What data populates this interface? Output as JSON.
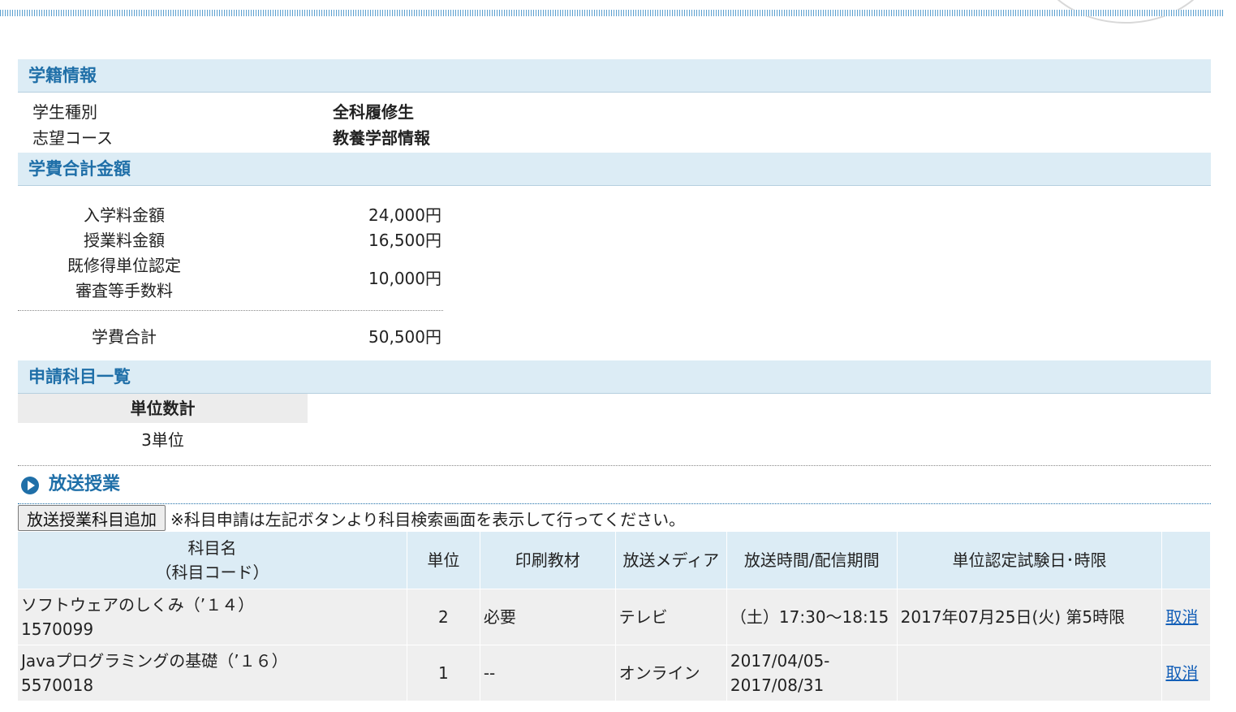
{
  "gakuseki": {
    "title": "学籍情報",
    "rows": [
      {
        "label": "学生種別",
        "value": "全科履修生"
      },
      {
        "label": "志望コース",
        "value": "教養学部情報"
      }
    ]
  },
  "fees": {
    "title": "学費合計金額",
    "rows": [
      {
        "label": "入学料金額",
        "value": "24,000円"
      },
      {
        "label": "授業料金額",
        "value": "16,500円"
      },
      {
        "label1": "既修得単位認定",
        "label2": "審査等手数料",
        "value": "10,000円"
      }
    ],
    "total_label": "学費合計",
    "total_value": "50,500円"
  },
  "subjects": {
    "title": "申請科目一覧",
    "units_header": "単位数計",
    "units_value": "3単位"
  },
  "broadcast": {
    "title": "放送授業",
    "add_button": "放送授業科目追加",
    "note": "※科目申請は左記ボタンより科目検索画面を表示して行ってください。",
    "headers": {
      "name1": "科目名",
      "name2": "（科目コード）",
      "unit": "単位",
      "print": "印刷教材",
      "media": "放送メディア",
      "time": "放送時間/配信期間",
      "exam": "単位認定試験日･時限"
    },
    "rows": [
      {
        "name": "ソフトウェアのしくみ（’１４）",
        "code": "1570099",
        "unit": "2",
        "print": "必要",
        "media": "テレビ",
        "time1": "（土）17:30～18:15",
        "time2": "",
        "exam": "2017年07月25日(火) 第5時限",
        "action": "取消"
      },
      {
        "name": "Javaプログラミングの基礎（’１６）",
        "code": "5570018",
        "unit": "1",
        "print": "--",
        "media": "オンライン",
        "time1": "2017/04/05-",
        "time2": "2017/08/31",
        "exam": "",
        "action": "取消"
      }
    ]
  }
}
